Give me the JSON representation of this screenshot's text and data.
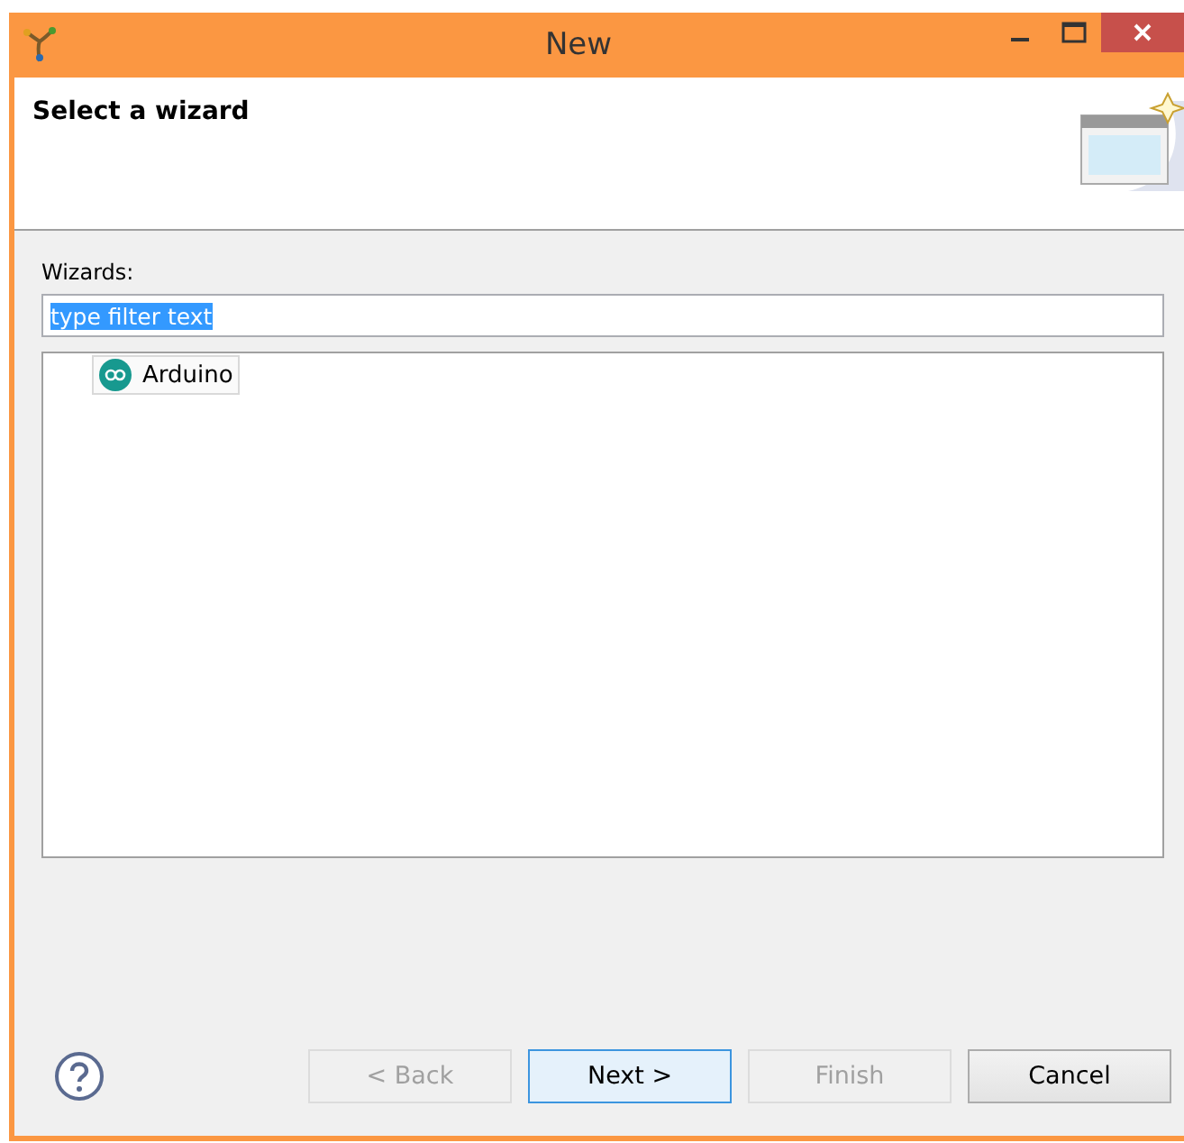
{
  "window": {
    "title": "New"
  },
  "header": {
    "title": "Select a wizard"
  },
  "filter": {
    "label": "Wizards:",
    "value": "type filter text",
    "text_selected": true
  },
  "tree": {
    "items": [
      {
        "label": "Arduino",
        "selected": true
      }
    ]
  },
  "buttons": [
    {
      "label": "< Back",
      "disabled": true,
      "default": false
    },
    {
      "label": "Next >",
      "disabled": false,
      "default": true
    },
    {
      "label": "Finish",
      "disabled": true,
      "default": false
    },
    {
      "label": "Cancel",
      "disabled": false,
      "default": false
    }
  ]
}
